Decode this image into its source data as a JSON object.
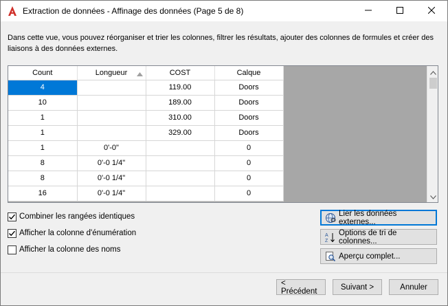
{
  "window": {
    "title": "Extraction de données - Affinage des données (Page 5 de 8)"
  },
  "description": "Dans cette vue, vous pouvez réorganiser et trier les colonnes, filtrer les résultats, ajouter des colonnes de formules et créer des liaisons à des données externes.",
  "grid": {
    "columns": [
      "Count",
      "Longueur",
      "COST",
      "Calque"
    ],
    "sorted_column": "Longueur",
    "rows": [
      [
        "4",
        "",
        "119.00",
        "Doors"
      ],
      [
        "10",
        "",
        "189.00",
        "Doors"
      ],
      [
        "1",
        "",
        "310.00",
        "Doors"
      ],
      [
        "1",
        "",
        "329.00",
        "Doors"
      ],
      [
        "1",
        "0'-0\"",
        "",
        "0"
      ],
      [
        "8",
        "0'-0 1/4\"",
        "",
        "0"
      ],
      [
        "8",
        "0'-0 1/4\"",
        "",
        "0"
      ],
      [
        "16",
        "0'-0 1/4\"",
        "",
        "0"
      ]
    ]
  },
  "options": {
    "combine_rows": {
      "label": "Combiner les rangées identiques",
      "checked": true
    },
    "show_count": {
      "label": "Afficher la colonne d'énumération",
      "checked": true
    },
    "show_names": {
      "label": "Afficher la colonne des noms",
      "checked": false
    }
  },
  "side_buttons": {
    "link_external": "Lier les données externes...",
    "sort_options": "Options de tri de colonnes...",
    "full_preview": "Aperçu complet..."
  },
  "footer": {
    "previous": "< Précédent",
    "next": "Suivant >",
    "cancel": "Annuler"
  },
  "colors": {
    "selection": "#0078d7",
    "app_icon": "#d0302a"
  }
}
